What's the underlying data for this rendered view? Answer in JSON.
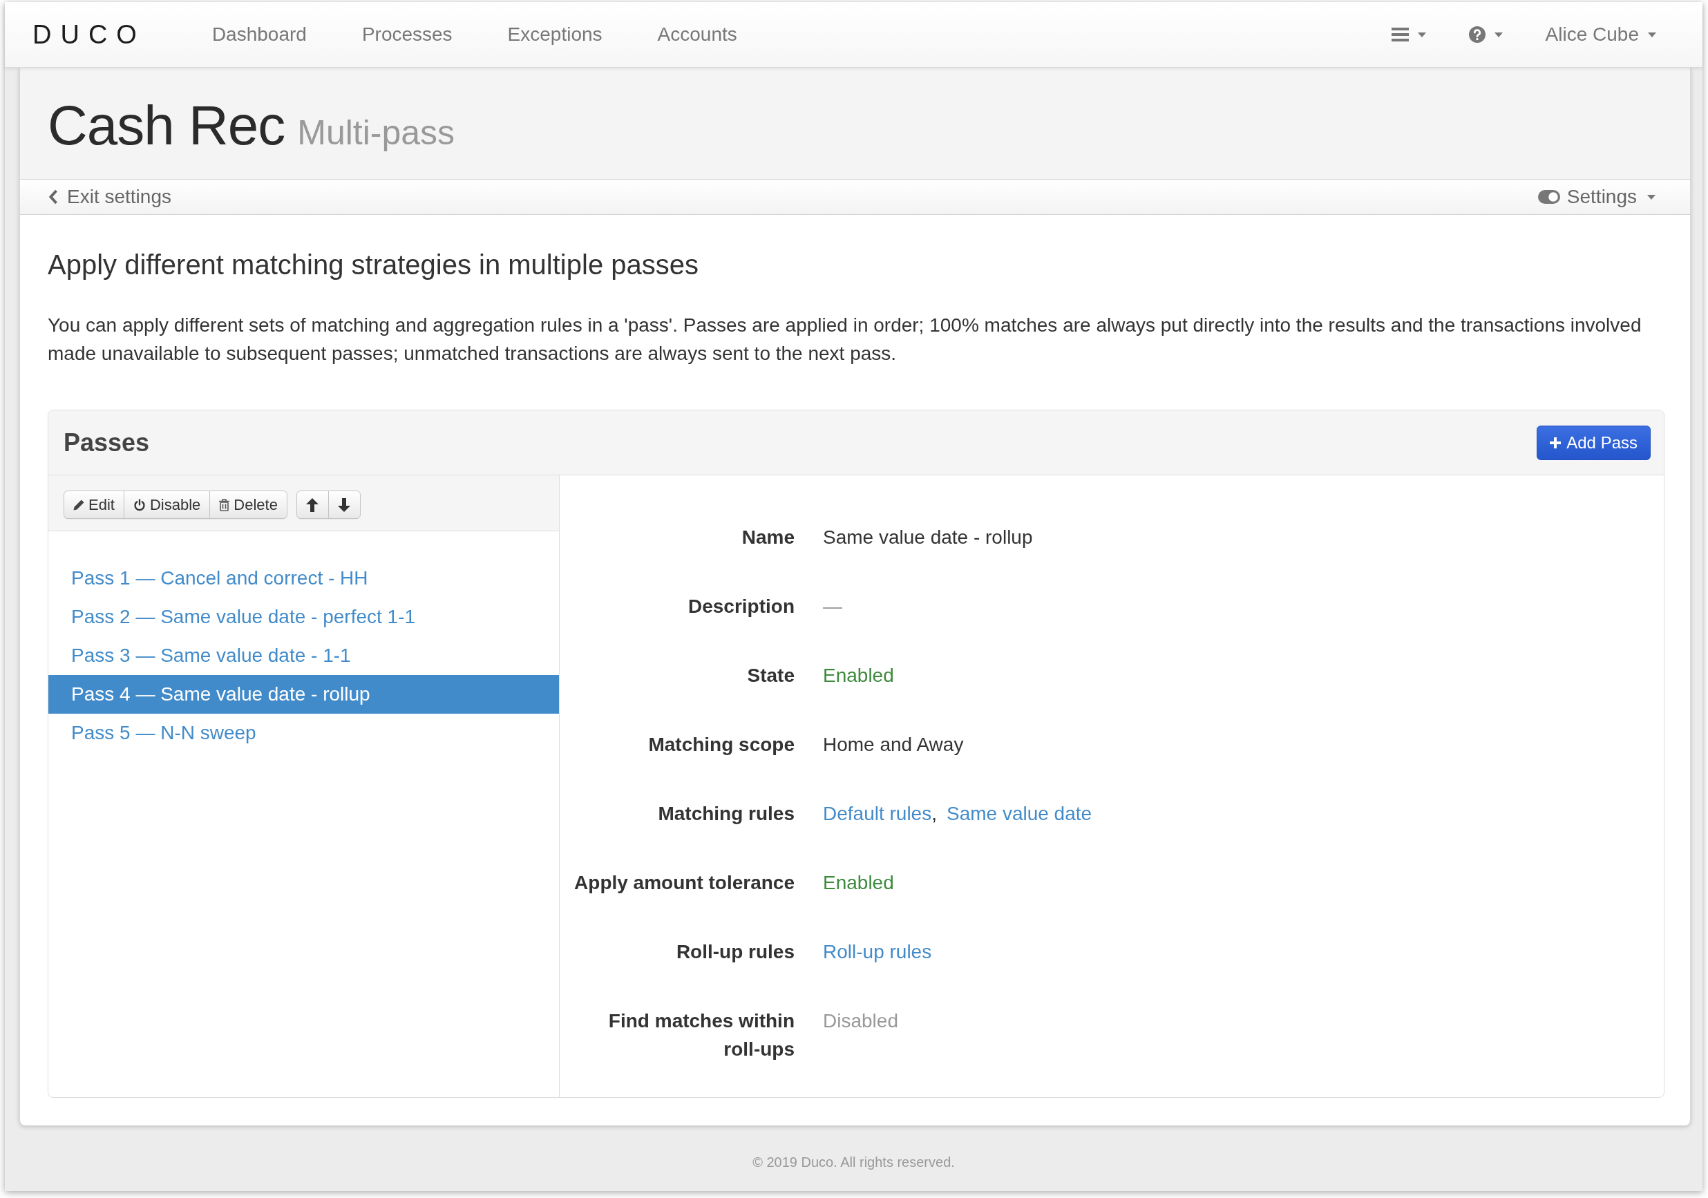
{
  "navbar": {
    "logo": "DUCO",
    "links": [
      {
        "label": "Dashboard"
      },
      {
        "label": "Processes"
      },
      {
        "label": "Exceptions"
      },
      {
        "label": "Accounts"
      }
    ],
    "dropdowns": [
      {
        "kind": "menu"
      },
      {
        "kind": "help"
      },
      {
        "kind": "user",
        "label": "Alice Cube"
      }
    ]
  },
  "page_header": {
    "title": "Cash Rec",
    "subtitle": "Multi-pass"
  },
  "settings_bar": {
    "back_link": "Exit settings",
    "settings_menu": "Settings"
  },
  "intro": {
    "heading": "Apply different matching strategies in multiple passes",
    "text": "You can apply different sets of matching and aggregation rules in a 'pass'. Passes are applied in order; 100% matches are always put directly into the results and the transactions involved made unavailable to subsequent passes; unmatched transactions are always sent to the next pass."
  },
  "passes_panel": {
    "title": "Passes",
    "add_button": "Add Pass",
    "toolbar": [
      {
        "buttons": [
          {
            "kind": "edit",
            "label": "Edit"
          },
          {
            "kind": "disable",
            "label": "Disable"
          },
          {
            "kind": "delete",
            "label": "Delete"
          }
        ]
      },
      {
        "buttons": [
          {
            "kind": "move_up"
          },
          {
            "kind": "move_down"
          }
        ]
      }
    ],
    "passes": [
      {
        "label": "Pass 1 — Cancel and correct - HH",
        "selected": false
      },
      {
        "label": "Pass 2 — Same value date - perfect 1-1",
        "selected": false
      },
      {
        "label": "Pass 3 — Same value date - 1-1",
        "selected": false
      },
      {
        "label": "Pass 4 — Same value date - rollup",
        "selected": true
      },
      {
        "label": "Pass 5 — N-N sweep",
        "selected": false
      }
    ],
    "details": [
      {
        "label": "Name",
        "values": [
          {
            "kind": "text",
            "text": "Same value date - rollup"
          }
        ]
      },
      {
        "label": "Description",
        "values": [
          {
            "kind": "muted",
            "text": "—"
          }
        ]
      },
      {
        "label": "State",
        "values": [
          {
            "kind": "success",
            "text": "Enabled"
          }
        ]
      },
      {
        "label": "Matching scope",
        "values": [
          {
            "kind": "text",
            "text": "Home and Away"
          }
        ]
      },
      {
        "label": "Matching rules",
        "values": [
          {
            "kind": "link",
            "text": "Default rules"
          },
          {
            "kind": "separator",
            "text": ","
          },
          {
            "kind": "link",
            "text": "Same value date"
          }
        ]
      },
      {
        "label": "Apply amount tolerance",
        "values": [
          {
            "kind": "success",
            "text": "Enabled"
          }
        ]
      },
      {
        "label": "Roll-up rules",
        "values": [
          {
            "kind": "link",
            "text": "Roll-up rules"
          }
        ]
      },
      {
        "label": "Find matches within roll-ups",
        "values": [
          {
            "kind": "muted",
            "text": "Disabled"
          }
        ]
      }
    ]
  },
  "footer": {
    "text": "© 2019 Duco. All rights reserved."
  }
}
